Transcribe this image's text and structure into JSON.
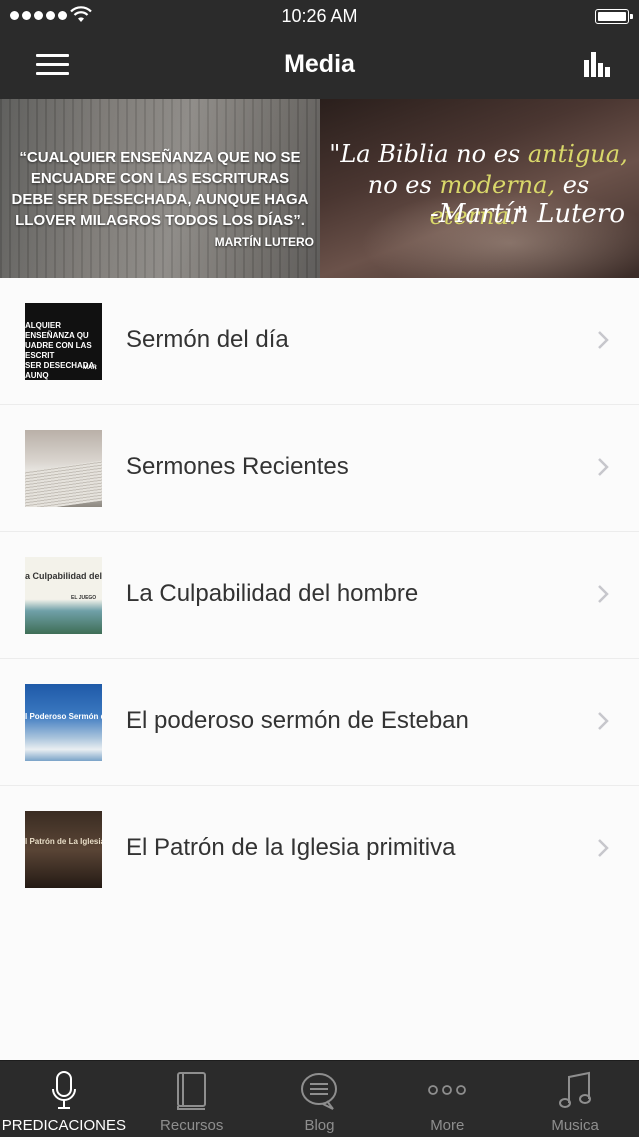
{
  "status_bar": {
    "time": "10:26 AM"
  },
  "nav": {
    "title": "Media"
  },
  "banner": {
    "left_quote": "“CUALQUIER ENSEÑANZA QUE NO SE ENCUADRE CON LAS ESCRITURAS DEBE SER DESECHADA, AUNQUE HAGA LLOVER MILAGROS TODOS LOS DÍAS”.",
    "left_author": "MARTÍN LUTERO",
    "right_quote_parts": [
      "\"La Biblia no es ",
      "antigua,",
      "no es ",
      "moderna,",
      " es ",
      "eterna.",
      "\""
    ],
    "right_author": "-Martín Lutero",
    "highlight_color": "#d9d86a"
  },
  "list": [
    {
      "title": "Sermón del día",
      "thumb_text": "ALQUIER ENSEÑANZA QU\nUADRE CON LAS ESCRIT\nSER DESECHADA, AUNQ\nMILAGROS TODOS LO",
      "thumb_small": "MAR"
    },
    {
      "title": "Sermones Recientes"
    },
    {
      "title": "La Culpabilidad del hombre",
      "thumb_text": "a Culpabilidad del Hombr",
      "thumb_small": "EL JUEGO"
    },
    {
      "title": "El poderoso sermón de Esteban",
      "thumb_text": "l Poderoso Sermón de Esteba"
    },
    {
      "title": "El Patrón de la Iglesia primitiva",
      "thumb_text": "l Patrón de La Iglesia Primi"
    }
  ],
  "tabs": [
    {
      "label": "PREDICACIONES",
      "icon": "microphone-icon",
      "active": true
    },
    {
      "label": "Recursos",
      "icon": "book-icon",
      "active": false
    },
    {
      "label": "Blog",
      "icon": "chat-bubble-icon",
      "active": false
    },
    {
      "label": "More",
      "icon": "ellipsis-icon",
      "active": false
    },
    {
      "label": "Musica",
      "icon": "music-note-icon",
      "active": false
    }
  ]
}
